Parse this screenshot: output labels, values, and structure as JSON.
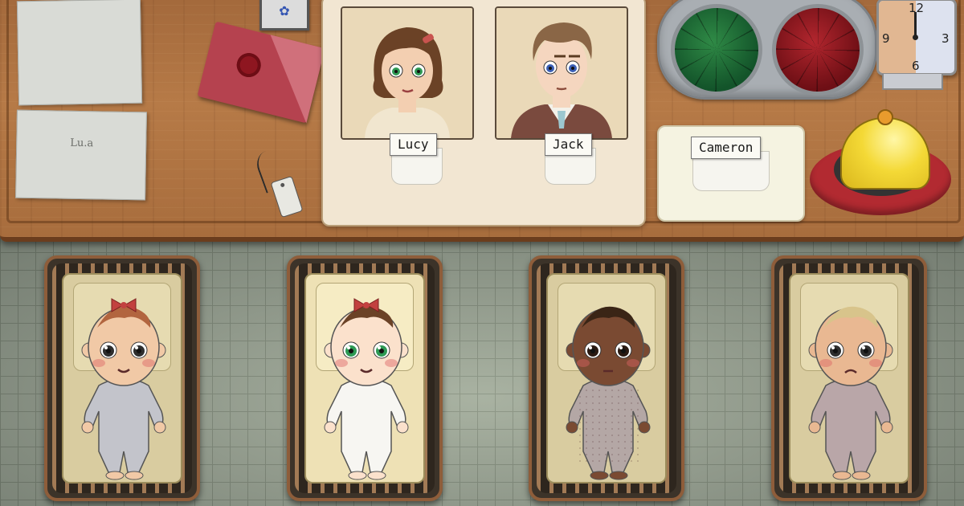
{
  "desk": {
    "note_text": "Lu.a",
    "photo_icon": "✿"
  },
  "parents": [
    {
      "name": "Lucy",
      "role": "mother",
      "eye_color": "#2e9a54",
      "hair_color": "#6b4226",
      "hair_clip_color": "#c9544f",
      "skin": "#f3cfb1",
      "clothes": "#f1e6cf"
    },
    {
      "name": "Jack",
      "role": "father",
      "eye_color": "#3b5fb5",
      "hair_color": "#8a6646",
      "skin": "#f5d6bf",
      "clothes": "#7a4a3e",
      "tie": "#9cc7cf"
    }
  ],
  "baby_card": {
    "name": "Cameron"
  },
  "clock": {
    "numbers": [
      "12",
      "3",
      "6",
      "9"
    ]
  },
  "verdict_buttons": {
    "green": "#1f7038",
    "red": "#9a1c24"
  },
  "cribs": [
    {
      "bow": true,
      "hair": "#b2653f",
      "skin": "#f1c9a6",
      "eyes": "#2e2e2e",
      "onesie": "#c3c4cb",
      "expression": "smile",
      "pattern": false
    },
    {
      "bow": true,
      "hair": "#6b4226",
      "skin": "#fbe1cc",
      "eyes": "#2e9a54",
      "onesie": "#f7f6f2",
      "expression": "smile",
      "pattern": false
    },
    {
      "bow": false,
      "hair": "#3a2516",
      "skin": "#7a4a32",
      "eyes": "#2a1a12",
      "onesie": "#b4a7a5",
      "expression": "neutral",
      "pattern": true
    },
    {
      "bow": false,
      "hair": "#d8c48b",
      "skin": "#e9b892",
      "eyes": "#2e2e2e",
      "onesie": "#b9a6a8",
      "expression": "frown",
      "pattern": false
    }
  ]
}
